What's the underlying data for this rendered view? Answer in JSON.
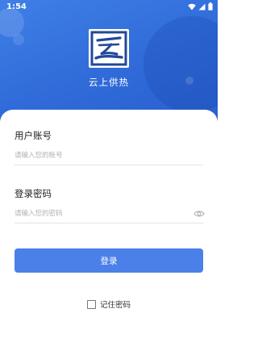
{
  "status_bar": {
    "time": "1:54",
    "icons": [
      "wifi-icon",
      "signal-icon",
      "battery-icon"
    ]
  },
  "app": {
    "name": "云上供热",
    "logo_icon": "app-logo-icon"
  },
  "form": {
    "username": {
      "label": "用户账号",
      "placeholder": "请输入您的账号",
      "value": ""
    },
    "password": {
      "label": "登录密码",
      "placeholder": "请输入您的密码",
      "value": "",
      "toggle_icon": "eye-icon"
    },
    "login_button": "登录",
    "remember": {
      "label": "记住密码",
      "checked": false
    }
  },
  "colors": {
    "header_blue": "#2f6ad8",
    "button_blue": "#4a80e8"
  }
}
